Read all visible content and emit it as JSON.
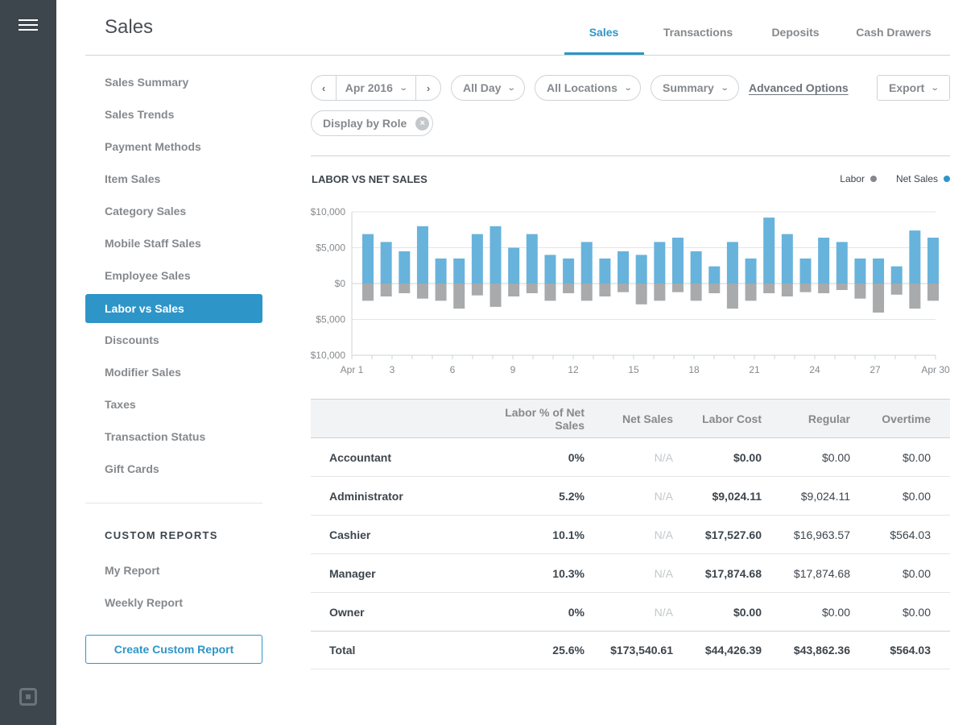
{
  "header": {
    "title": "Sales",
    "tabs": [
      {
        "label": "Sales",
        "active": true
      },
      {
        "label": "Transactions",
        "active": false
      },
      {
        "label": "Deposits",
        "active": false
      },
      {
        "label": "Cash Drawers",
        "active": false
      }
    ]
  },
  "rail": {
    "menu_icon": "hamburger-menu-icon",
    "logo_icon": "square-logo-icon"
  },
  "sidebar": {
    "items": [
      {
        "label": "Sales Summary",
        "active": false
      },
      {
        "label": "Sales Trends",
        "active": false
      },
      {
        "label": "Payment Methods",
        "active": false
      },
      {
        "label": "Item Sales",
        "active": false
      },
      {
        "label": "Category Sales",
        "active": false
      },
      {
        "label": "Mobile Staff Sales",
        "active": false
      },
      {
        "label": "Employee Sales",
        "active": false
      },
      {
        "label": "Labor vs Sales",
        "active": true
      },
      {
        "label": "Discounts",
        "active": false
      },
      {
        "label": "Modifier Sales",
        "active": false
      },
      {
        "label": "Taxes",
        "active": false
      },
      {
        "label": "Transaction Status",
        "active": false
      },
      {
        "label": "Gift Cards",
        "active": false
      }
    ],
    "custom_heading": "CUSTOM REPORTS",
    "custom_items": [
      "My Report",
      "Weekly Report"
    ],
    "create_button": "Create Custom Report"
  },
  "filters": {
    "prev": "‹",
    "date": "Apr 2016",
    "next": "›",
    "time": "All Day",
    "locations": "All Locations",
    "view": "Summary",
    "advanced": "Advanced Options",
    "export": "Export",
    "chip": "Display by Role",
    "chip_remove": "×",
    "chevron": "⌄"
  },
  "chart_data": {
    "type": "bar",
    "title": "LABOR VS NET SALES",
    "legend": [
      {
        "name": "Labor",
        "color": "#a8aaac"
      },
      {
        "name": "Net Sales",
        "color": "#2e95c8"
      }
    ],
    "legend_position": "top-right",
    "ylim": [
      -10000,
      10000
    ],
    "y_ticks": [
      {
        "value": 10000,
        "label": "$10,000"
      },
      {
        "value": 5000,
        "label": "$5,000"
      },
      {
        "value": 0,
        "label": "$0"
      },
      {
        "value": -5000,
        "label": "$5,000"
      },
      {
        "value": -10000,
        "label": "$10,000"
      }
    ],
    "x_ticks": [
      {
        "day": 1,
        "label": "Apr 1"
      },
      {
        "day": 3,
        "label": "3"
      },
      {
        "day": 6,
        "label": "6"
      },
      {
        "day": 9,
        "label": "9"
      },
      {
        "day": 12,
        "label": "12"
      },
      {
        "day": 15,
        "label": "15"
      },
      {
        "day": 18,
        "label": "18"
      },
      {
        "day": 21,
        "label": "21"
      },
      {
        "day": 24,
        "label": "24"
      },
      {
        "day": 27,
        "label": "27"
      },
      {
        "day": 30,
        "label": "Apr 30"
      }
    ],
    "xlim": [
      1,
      30
    ],
    "grid": true,
    "series": [
      {
        "name": "Net Sales",
        "color": "#67b3dc",
        "values": [
          6900,
          5800,
          4500,
          8000,
          3500,
          3500,
          6900,
          8000,
          5000,
          6900,
          4000,
          3500,
          5800,
          3500,
          4500,
          4000,
          5800,
          6400,
          4500,
          2400,
          5800,
          3500,
          9200,
          6900,
          3500,
          6400,
          5800,
          3500,
          3500,
          2400,
          7400,
          6400
        ]
      },
      {
        "name": "Labor",
        "color": "#a8aaac",
        "values": [
          -2400,
          -1800,
          -1350,
          -2100,
          -2400,
          -3500,
          -1650,
          -3250,
          -1800,
          -1350,
          -2400,
          -1350,
          -2400,
          -1800,
          -1200,
          -2900,
          -2400,
          -1200,
          -2400,
          -1350,
          -3500,
          -2400,
          -1350,
          -1800,
          -1200,
          -1350,
          -900,
          -2100,
          -4050,
          -1550,
          -3500,
          -2400
        ]
      }
    ]
  },
  "table": {
    "headers": [
      "",
      "Labor % of Net Sales",
      "Net Sales",
      "Labor Cost",
      "Regular",
      "Overtime"
    ],
    "rows": [
      [
        "Accountant",
        "0%",
        "N/A",
        "$0.00",
        "$0.00",
        "$0.00"
      ],
      [
        "Administrator",
        "5.2%",
        "N/A",
        "$9,024.11",
        "$9,024.11",
        "$0.00"
      ],
      [
        "Cashier",
        "10.1%",
        "N/A",
        "$17,527.60",
        "$16,963.57",
        "$564.03"
      ],
      [
        "Manager",
        "10.3%",
        "N/A",
        "$17,874.68",
        "$17,874.68",
        "$0.00"
      ],
      [
        "Owner",
        "0%",
        "N/A",
        "$0.00",
        "$0.00",
        "$0.00"
      ]
    ],
    "total": [
      "Total",
      "25.6%",
      "$173,540.61",
      "$44,426.39",
      "$43,862.36",
      "$564.03"
    ]
  }
}
